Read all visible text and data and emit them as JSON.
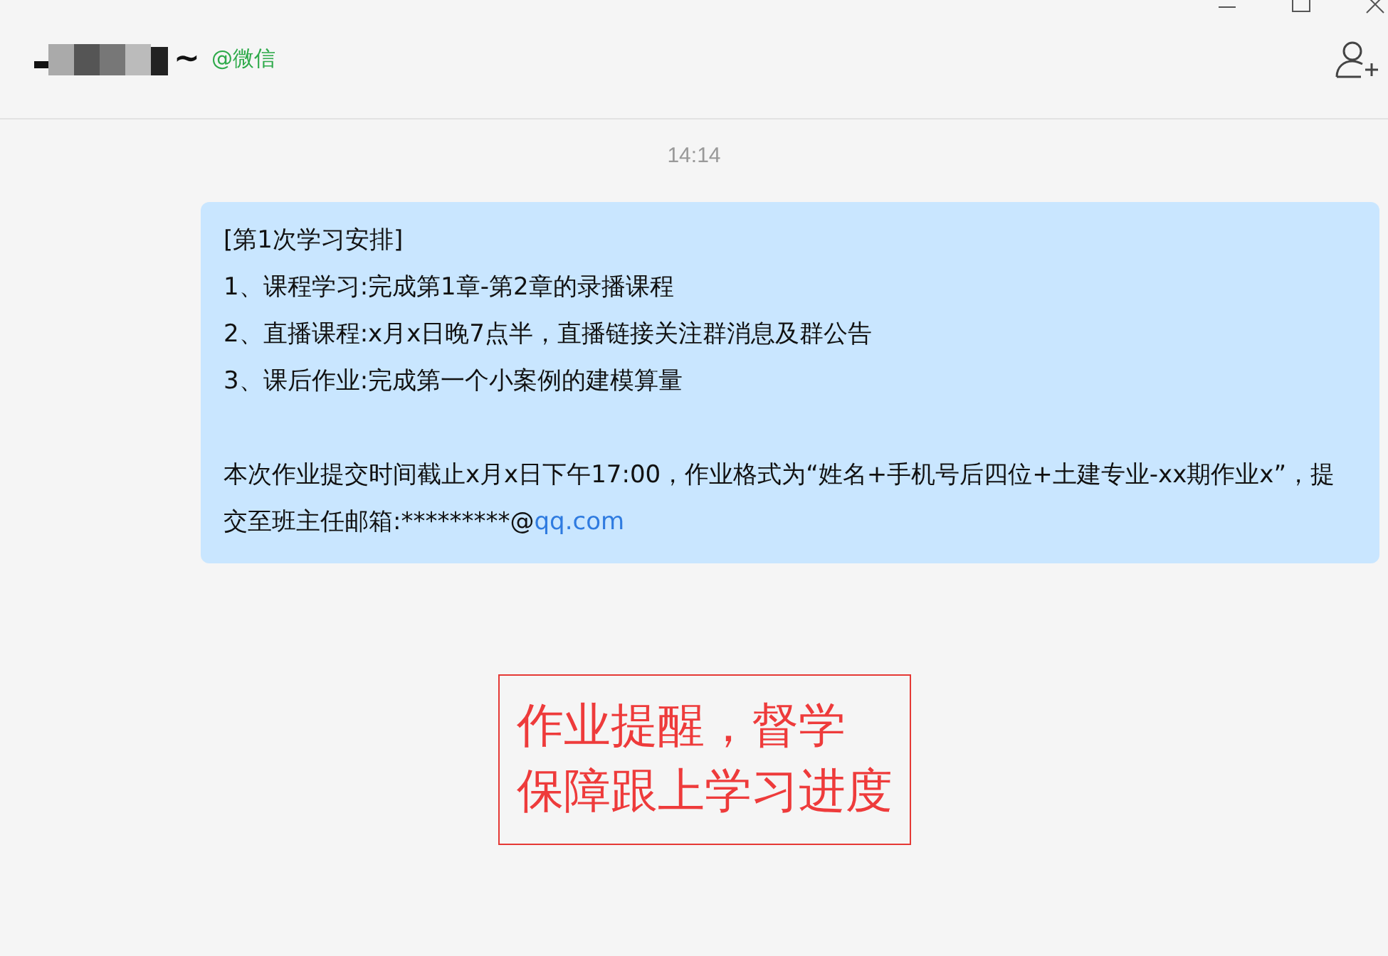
{
  "header": {
    "name_tail": "~",
    "source": "@微信"
  },
  "time": "14:14",
  "message": {
    "lines": [
      "[第1次学习安排]",
      "1、课程学习:完成第1章-第2章的录播课程",
      "2、直播课程:x月x日晚7点半，直播链接关注群消息及群公告",
      "3、课后作业:完成第一个小案例的建模算量"
    ],
    "note": "本次作业提交时间截止x月x日下午17:00，作业格式为“姓名+手机号后四位+土建专业-xx期作业x”，提交至班主任邮箱:*********@",
    "link": "qq.com"
  },
  "annotation": {
    "lines": [
      "作业提醒，督学",
      "保障跟上学习进度"
    ]
  }
}
